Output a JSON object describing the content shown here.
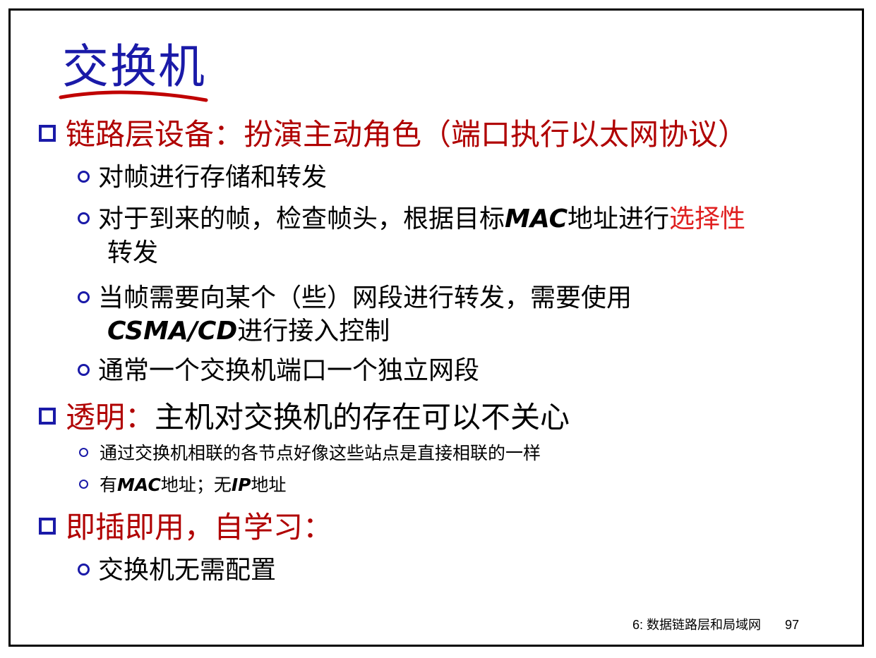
{
  "title": "交换机",
  "sections": {
    "s1": {
      "heading": "链路层设备：扮演主动角色（端口执行以太网协议）",
      "items": {
        "a": "对帧进行存储和转发",
        "b_part1": "对于到来的帧，检查帧头，根据目标",
        "b_mac": "MAC",
        "b_part2": "地址进行",
        "b_highlight": "选择性",
        "b_line2": "转发",
        "c_line1": "当帧需要向某个（些）网段进行转发，需要使用",
        "c_csma": "CSMA/CD",
        "c_line2": "进行接入控制",
        "d": "通常一个交换机端口一个独立网段"
      }
    },
    "s2": {
      "heading_red": "透明：",
      "heading_rest": "主机对交换机的存在可以不关心",
      "items": {
        "a": "通过交换机相联的各节点好像这些站点是直接相联的一样",
        "b_pre": "有",
        "b_mac": "MAC",
        "b_mid": "地址；无",
        "b_ip": "IP",
        "b_post": "地址"
      }
    },
    "s3": {
      "heading": "即插即用，自学习：",
      "items": {
        "a": "交换机无需配置"
      }
    }
  },
  "footer": {
    "chapter": "6: 数据链路层和局域网",
    "page": "97"
  },
  "colors": {
    "title": "#1a1aa8",
    "heading": "#b00000",
    "highlight": "#e02020",
    "bullet": "#1a1aa8",
    "underline": "#c00000"
  }
}
